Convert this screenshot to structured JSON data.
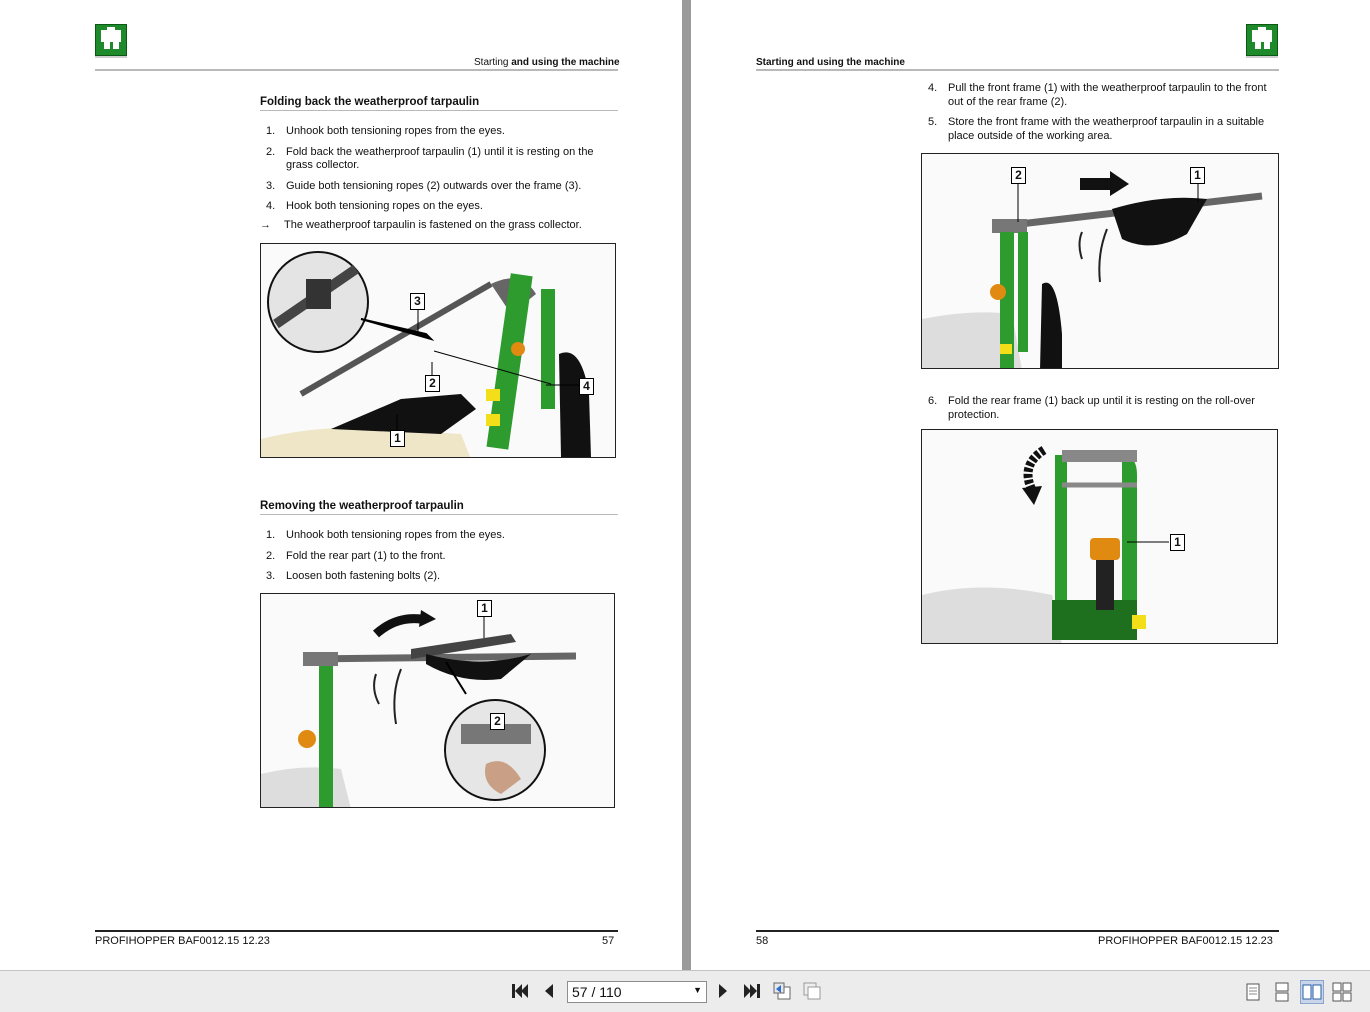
{
  "viewer": {
    "page_field": "57 / 110",
    "icons": {
      "first": "first-page-icon",
      "prev": "previous-page-icon",
      "next": "next-page-icon",
      "last": "last-page-icon",
      "back": "back-view-icon",
      "forward": "forward-view-icon",
      "single": "single-page-view-icon",
      "continuous": "continuous-view-icon",
      "facing": "facing-pages-view-icon",
      "continuous_facing": "continuous-facing-view-icon"
    }
  },
  "left_page": {
    "header": {
      "prefix": "Starting ",
      "bold": "and using the machine"
    },
    "section1": {
      "title": "Folding back the weatherproof tarpaulin",
      "steps": [
        {
          "num": "1.",
          "text": "Unhook both tensioning ropes from the eyes."
        },
        {
          "num": "2.",
          "text": "Fold back the weatherproof tarpaulin (1) until it is resting on the grass collector."
        },
        {
          "num": "3.",
          "text": "Guide both tensioning ropes (2) outwards over the frame (3)."
        },
        {
          "num": "4.",
          "text": "Hook both tensioning ropes on the eyes."
        }
      ],
      "result_arrow": "→",
      "result": "The weatherproof tarpaulin is fastened on the grass collector.",
      "callouts": [
        "3",
        "2",
        "4",
        "1"
      ]
    },
    "section2": {
      "title": "Removing the weatherproof tarpaulin",
      "steps": [
        {
          "num": "1.",
          "text": "Unhook both tensioning ropes from the eyes."
        },
        {
          "num": "2.",
          "text": "Fold the rear part (1) to the front."
        },
        {
          "num": "3.",
          "text": "Loosen both fastening bolts (2)."
        }
      ],
      "callouts": [
        "1",
        "2"
      ]
    },
    "footer": {
      "doc": "PROFIHOPPER  BAF0012.15  12.23",
      "page": "57"
    }
  },
  "right_page": {
    "header": "Starting and using the machine",
    "steps_a": [
      {
        "num": "4.",
        "text": "Pull the front frame (1) with the weatherproof tarpaulin to the front out of the rear frame (2)."
      },
      {
        "num": "5.",
        "text": "Store the front frame with the weatherproof tarpaulin in a suitable place outside of the working area."
      }
    ],
    "figure_a_callouts": [
      "2",
      "1"
    ],
    "steps_b": [
      {
        "num": "6.",
        "text": "Fold the rear frame (1) back up until it is resting on the roll-over protection."
      }
    ],
    "figure_b_callouts": [
      "1"
    ],
    "footer": {
      "page": "58",
      "doc": "PROFIHOPPER  BAF0012.15  12.23"
    }
  },
  "colors": {
    "brand_green": "#1f8a2b",
    "frame_green": "#2e9b2e",
    "beacon_orange": "#e08a12"
  }
}
